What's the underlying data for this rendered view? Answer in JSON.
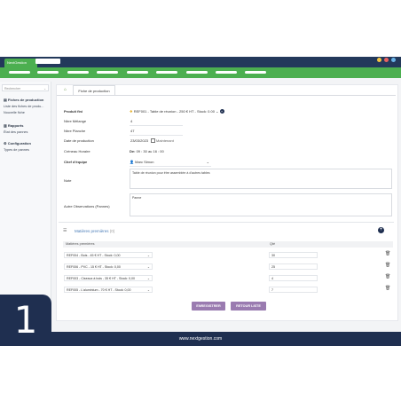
{
  "app": {
    "brand": "NextGestion",
    "footer_url": "www.nextgestion.com",
    "badge_number": "1",
    "colors": {
      "navy": "#23395b",
      "green": "#4caf50",
      "purple": "#9a7bb0"
    }
  },
  "sidebar": {
    "search_placeholder": "Rechercher",
    "section1_title": "Fiches de production",
    "section1_items": [
      "Liste des fiches de produ...",
      "Nouvelle fiche"
    ],
    "section2_title": "Rapports",
    "section2_items": [
      "État des pannes"
    ],
    "section3_title": "Configuration",
    "section3_items": [
      "Types de pannes"
    ]
  },
  "tabs": {
    "active": "Fiche de production"
  },
  "form": {
    "produit_label": "Produit fini",
    "produit_value": "REF001 - Table de réunion - 250 € HT - Stock: 0.00",
    "melange_label": "Nbre Mélange",
    "melange_value": "4",
    "planche_label": "Nbre Planche",
    "planche_value": "47",
    "date_label": "Date de production",
    "date_value": "23/03/2023",
    "date_link": "Maintenant",
    "creneau_label": "Créneau Horaire",
    "creneau_de": "De:",
    "creneau_de_value": "09  :  30",
    "creneau_au": "au",
    "creneau_au_value": "16  :  00",
    "chef_label": "Chef d'équipe",
    "chef_value": "Marc Simon",
    "note_label": "Note",
    "note_value": "Table de réunion pour être assemblée à d'autres tables",
    "autres_label": "Autre Observations (Pannes)",
    "autres_value": "Panne"
  },
  "materials": {
    "title": "Matières premières",
    "count": "(0)",
    "col_product": "Matières premières",
    "col_qty": "Qté",
    "rows": [
      {
        "product": "REF004 - Bois - 45 € HT - Stock: 0,00",
        "qty": "30"
      },
      {
        "product": "REF006 - PVC - 15 € HT - Stock: 0,00",
        "qty": "25"
      },
      {
        "product": "REF003 - Ciseaux à bois - 35 € HT - Stock: 0,00",
        "qty": "4"
      },
      {
        "product": "REF005 - L'aluminium - 70 € HT - Stock: 0,00",
        "qty": "7"
      }
    ]
  },
  "buttons": {
    "save": "ENREGISTRER",
    "back": "RETOUR LISTE"
  },
  "icons": {
    "home": "home-icon",
    "list": "list-icon",
    "add": "plus-circle-icon",
    "trash": "trash-icon",
    "user": "user-icon",
    "calendar": "calendar-icon"
  }
}
